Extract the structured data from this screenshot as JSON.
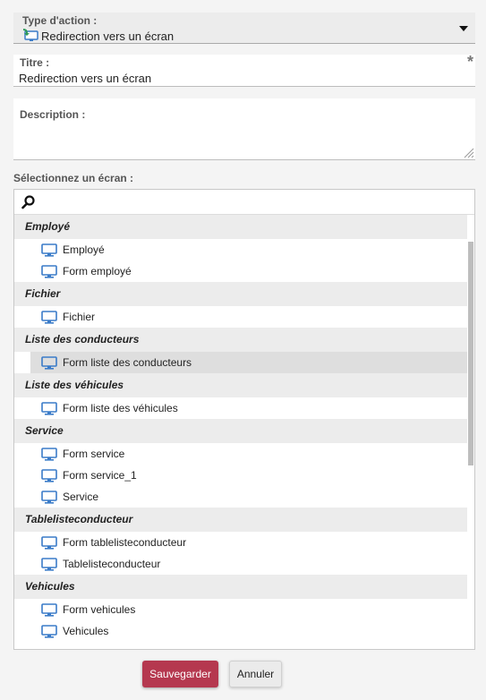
{
  "form": {
    "type_label": "Type d'action :",
    "type_value": "Redirection vers un écran",
    "title_label": "Titre :",
    "title_value": "Redirection vers un écran",
    "required_mark": "*",
    "description_label": "Description :",
    "screen_select_label": "Sélectionnez un écran :"
  },
  "screen_groups": [
    {
      "name": "Employé",
      "items": [
        "Employé",
        "Form employé"
      ]
    },
    {
      "name": "Fichier",
      "items": [
        "Fichier"
      ]
    },
    {
      "name": "Liste des conducteurs",
      "items": [
        "Form liste des conducteurs"
      ]
    },
    {
      "name": "Liste des véhicules",
      "items": [
        "Form liste des véhicules"
      ]
    },
    {
      "name": "Service",
      "items": [
        "Form service",
        "Form service_1",
        "Service"
      ]
    },
    {
      "name": "Tablelisteconducteur",
      "items": [
        "Form tablelisteconducteur",
        "Tablelisteconducteur"
      ]
    },
    {
      "name": "Vehicules",
      "items": [
        "Form vehicules",
        "Vehicules"
      ]
    }
  ],
  "selected_item": "Form liste des conducteurs",
  "buttons": {
    "save": "Sauvegarder",
    "cancel": "Annuler"
  },
  "icons": {
    "item": "monitor-icon",
    "search": "search-icon",
    "action_type": "screen-redirect-icon"
  },
  "colors": {
    "save_button": "#b5384f",
    "monitor_icon": "#3a7bc8"
  }
}
